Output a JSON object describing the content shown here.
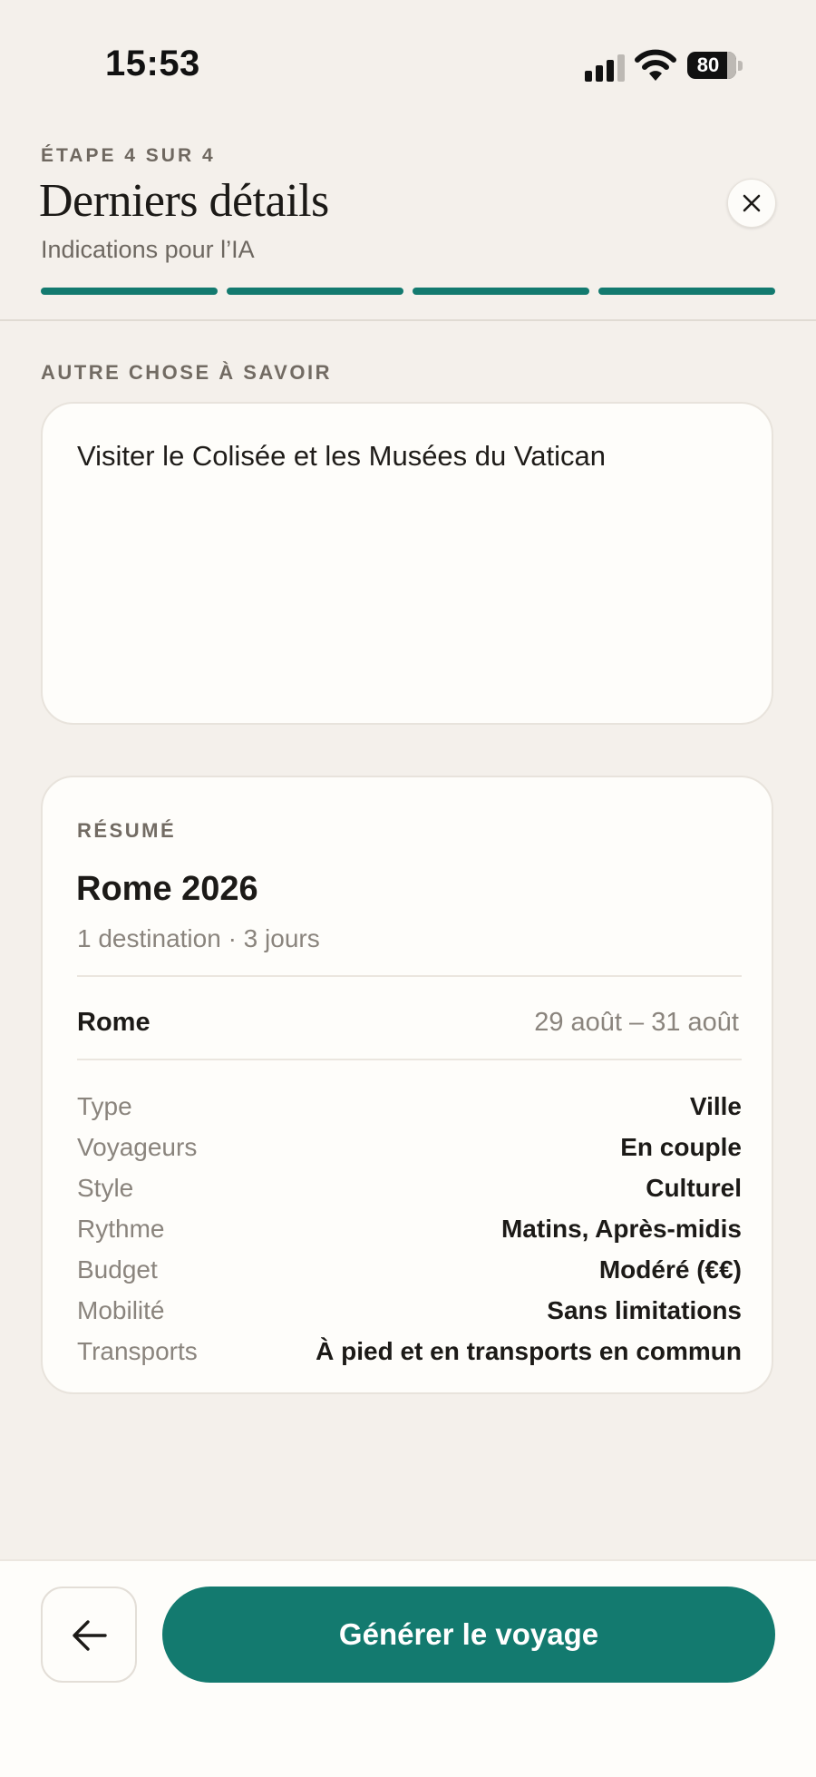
{
  "status_bar": {
    "time": "15:53",
    "battery": "80"
  },
  "header": {
    "step_label": "ÉTAPE 4 SUR 4",
    "title": "Derniers détails",
    "subtitle": "Indications pour l’IA",
    "progress": {
      "completed_steps": 4,
      "total_steps": 4
    },
    "accent_color": "#137a6f"
  },
  "notes": {
    "section_label": "AUTRE CHOSE À SAVOIR",
    "value": "Visiter le Colisée et les Musées du Vatican"
  },
  "summary": {
    "label": "RÉSUMÉ",
    "trip_name": "Rome 2026",
    "trip_meta": "1 destination · 3 jours",
    "destination": {
      "name": "Rome",
      "dates": "29 août – 31 août"
    },
    "rows": [
      {
        "key": "Type",
        "value": "Ville"
      },
      {
        "key": "Voyageurs",
        "value": "En couple"
      },
      {
        "key": "Style",
        "value": "Culturel"
      },
      {
        "key": "Rythme",
        "value": "Matins, Après-midis"
      },
      {
        "key": "Budget",
        "value": "Modéré (€€)"
      },
      {
        "key": "Mobilité",
        "value": "Sans limitations"
      },
      {
        "key": "Transports",
        "value": "À pied et en transports en commun"
      }
    ]
  },
  "footer": {
    "generate_label": "Générer le voyage"
  },
  "icons": [
    "signal-icon",
    "wifi-icon",
    "battery-icon",
    "close-icon",
    "arrow-left-icon"
  ]
}
